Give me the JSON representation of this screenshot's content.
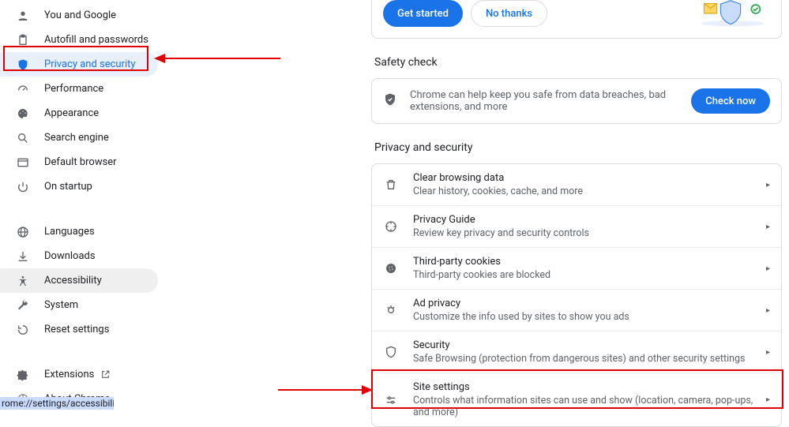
{
  "sidebar": {
    "items": [
      {
        "label": "You and Google"
      },
      {
        "label": "Autofill and passwords"
      },
      {
        "label": "Privacy and security"
      },
      {
        "label": "Performance"
      },
      {
        "label": "Appearance"
      },
      {
        "label": "Search engine"
      },
      {
        "label": "Default browser"
      },
      {
        "label": "On startup"
      }
    ],
    "items2": [
      {
        "label": "Languages"
      },
      {
        "label": "Downloads"
      },
      {
        "label": "Accessibility"
      },
      {
        "label": "System"
      },
      {
        "label": "Reset settings"
      }
    ],
    "items3": [
      {
        "label": "Extensions"
      },
      {
        "label": "About Chrome"
      }
    ]
  },
  "url_preview": "rome://settings/accessibility",
  "promo": {
    "get_started": "Get started",
    "no_thanks": "No thanks"
  },
  "safety": {
    "heading": "Safety check",
    "text": "Chrome can help keep you safe from data breaches, bad extensions, and more",
    "button": "Check now"
  },
  "privacy": {
    "heading": "Privacy and security",
    "rows": [
      {
        "title": "Clear browsing data",
        "sub": "Clear history, cookies, cache, and more"
      },
      {
        "title": "Privacy Guide",
        "sub": "Review key privacy and security controls"
      },
      {
        "title": "Third-party cookies",
        "sub": "Third-party cookies are blocked"
      },
      {
        "title": "Ad privacy",
        "sub": "Customize the info used by sites to show you ads"
      },
      {
        "title": "Security",
        "sub": "Safe Browsing (protection from dangerous sites) and other security settings"
      },
      {
        "title": "Site settings",
        "sub": "Controls what information sites can use and show (location, camera, pop-ups, and more)"
      }
    ]
  }
}
